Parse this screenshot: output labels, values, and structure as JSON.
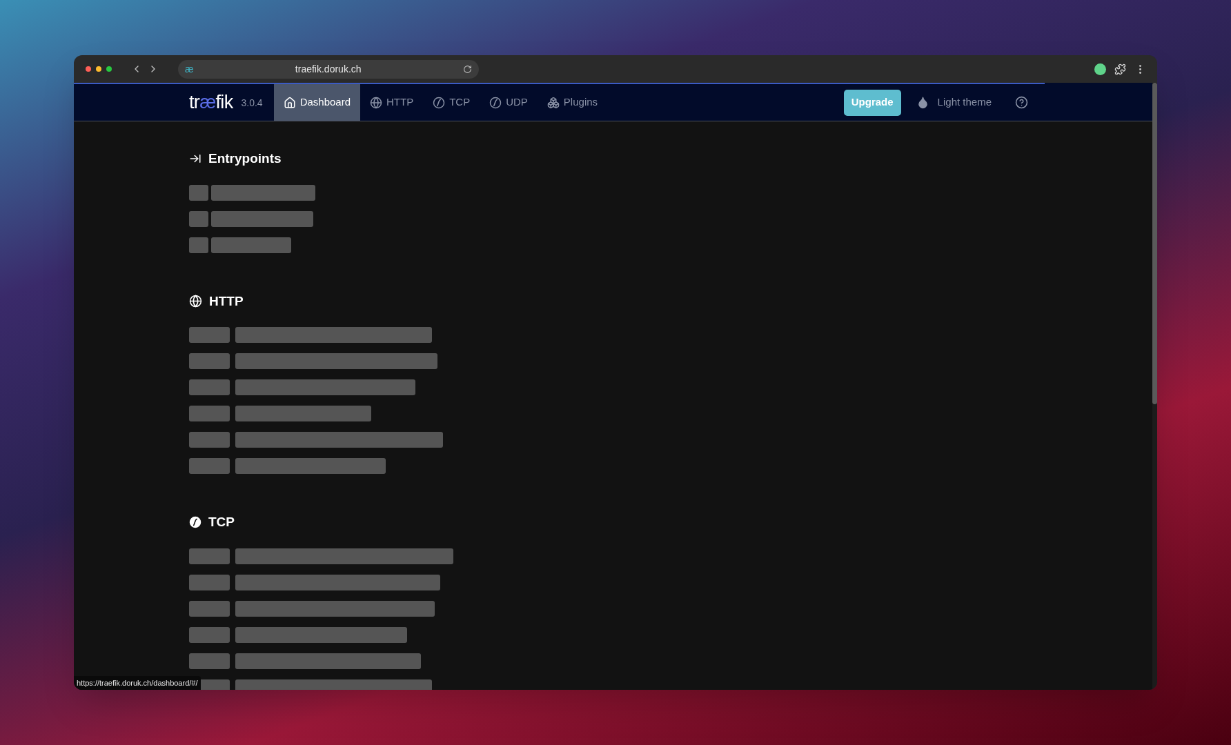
{
  "browser": {
    "favicon": "æ",
    "url": "traefik.doruk.ch",
    "page_load": {
      "level": 0.9
    },
    "status_url": "https://traefik.doruk.ch/dashboard/#/"
  },
  "nav": {
    "logo": "træfik",
    "version": "3.0.4",
    "tabs": [
      {
        "label": "Dashboard",
        "selected": true
      },
      {
        "label": "HTTP",
        "selected": false
      },
      {
        "label": "TCP",
        "selected": false
      },
      {
        "label": "UDP",
        "selected": false
      },
      {
        "label": "Plugins",
        "selected": false
      }
    ],
    "upgrade": "Upgrade",
    "theme_toggle": "Light theme"
  },
  "sections": [
    {
      "title": "Entrypoints",
      "kind": "entrypoints"
    },
    {
      "title": "HTTP",
      "kind": "http"
    },
    {
      "title": "TCP",
      "kind": "tcp"
    }
  ]
}
